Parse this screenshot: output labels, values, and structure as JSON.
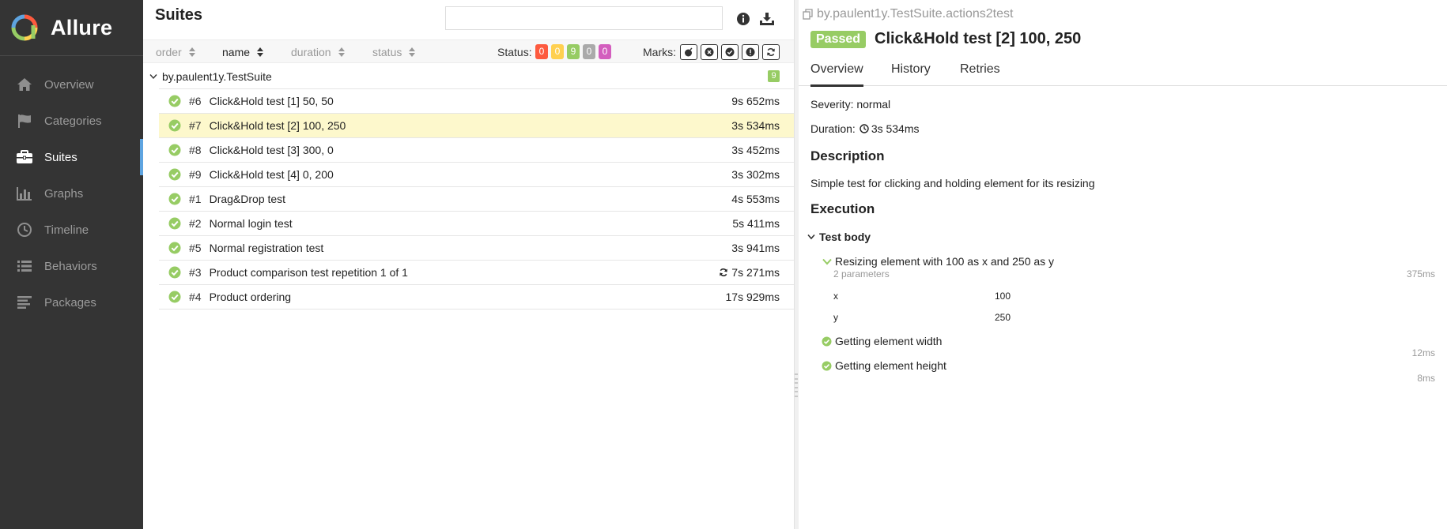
{
  "sidebar": {
    "brand": "Allure",
    "items": [
      {
        "label": "Overview",
        "icon": "home-icon"
      },
      {
        "label": "Categories",
        "icon": "flag-icon"
      },
      {
        "label": "Suites",
        "icon": "briefcase-icon",
        "active": true
      },
      {
        "label": "Graphs",
        "icon": "bar-chart-icon"
      },
      {
        "label": "Timeline",
        "icon": "clock-icon"
      },
      {
        "label": "Behaviors",
        "icon": "list-icon"
      },
      {
        "label": "Packages",
        "icon": "align-left-icon"
      }
    ]
  },
  "suites": {
    "title": "Suites",
    "search": {
      "value": "",
      "placeholder": ""
    },
    "sort_columns": {
      "order": "order",
      "name": "name",
      "duration": "duration",
      "status": "status"
    },
    "status_label": "Status:",
    "status_counts": [
      {
        "count": "0",
        "color": "#fd5a3e"
      },
      {
        "count": "0",
        "color": "#ffd050"
      },
      {
        "count": "9",
        "color": "#97cc64"
      },
      {
        "count": "0",
        "color": "#aaaaaa"
      },
      {
        "count": "0",
        "color": "#d35ebe"
      }
    ],
    "marks_label": "Marks:",
    "group": {
      "name": "by.paulent1y.TestSuite",
      "count": "9"
    },
    "tests": [
      {
        "num": "#6",
        "name": "Click&Hold test [1] 50, 50",
        "duration": "9s 652ms"
      },
      {
        "num": "#7",
        "name": "Click&Hold test [2] 100, 250",
        "duration": "3s 534ms",
        "selected": true
      },
      {
        "num": "#8",
        "name": "Click&Hold test [3] 300, 0",
        "duration": "3s 452ms"
      },
      {
        "num": "#9",
        "name": "Click&Hold test [4] 0, 200",
        "duration": "3s 302ms"
      },
      {
        "num": "#1",
        "name": "Drag&Drop test",
        "duration": "4s 553ms"
      },
      {
        "num": "#2",
        "name": "Normal login test",
        "duration": "5s 411ms"
      },
      {
        "num": "#5",
        "name": "Normal registration test",
        "duration": "3s 941ms"
      },
      {
        "num": "#3",
        "name": "Product comparison test repetition 1 of 1",
        "duration": "7s 271ms",
        "retried": true
      },
      {
        "num": "#4",
        "name": "Product ordering",
        "duration": "17s 929ms"
      }
    ]
  },
  "details": {
    "breadcrumb": "by.paulent1y.TestSuite.actions2test",
    "status": "Passed",
    "title": "Click&Hold test [2] 100, 250",
    "tabs": [
      "Overview",
      "History",
      "Retries"
    ],
    "severity": "Severity: normal",
    "duration_label": "Duration:",
    "duration": "3s 534ms",
    "description_heading": "Description",
    "description": "Simple test for clicking and holding element for its resizing",
    "execution_heading": "Execution",
    "test_body_label": "Test body",
    "steps": [
      {
        "name": "Resizing element with 100 as x and 250 as y",
        "meta": "2 parameters",
        "duration": "375ms",
        "params": [
          {
            "name": "x",
            "value": "100"
          },
          {
            "name": "y",
            "value": "250"
          }
        ]
      },
      {
        "name": "Getting element width",
        "duration": "12ms"
      },
      {
        "name": "Getting element height",
        "duration": "8ms"
      }
    ]
  },
  "colors": {
    "passed": "#97cc64",
    "sidebar_bg": "#343434",
    "active_accent": "#5ea4e0",
    "selected_row": "#fdf8cc"
  }
}
